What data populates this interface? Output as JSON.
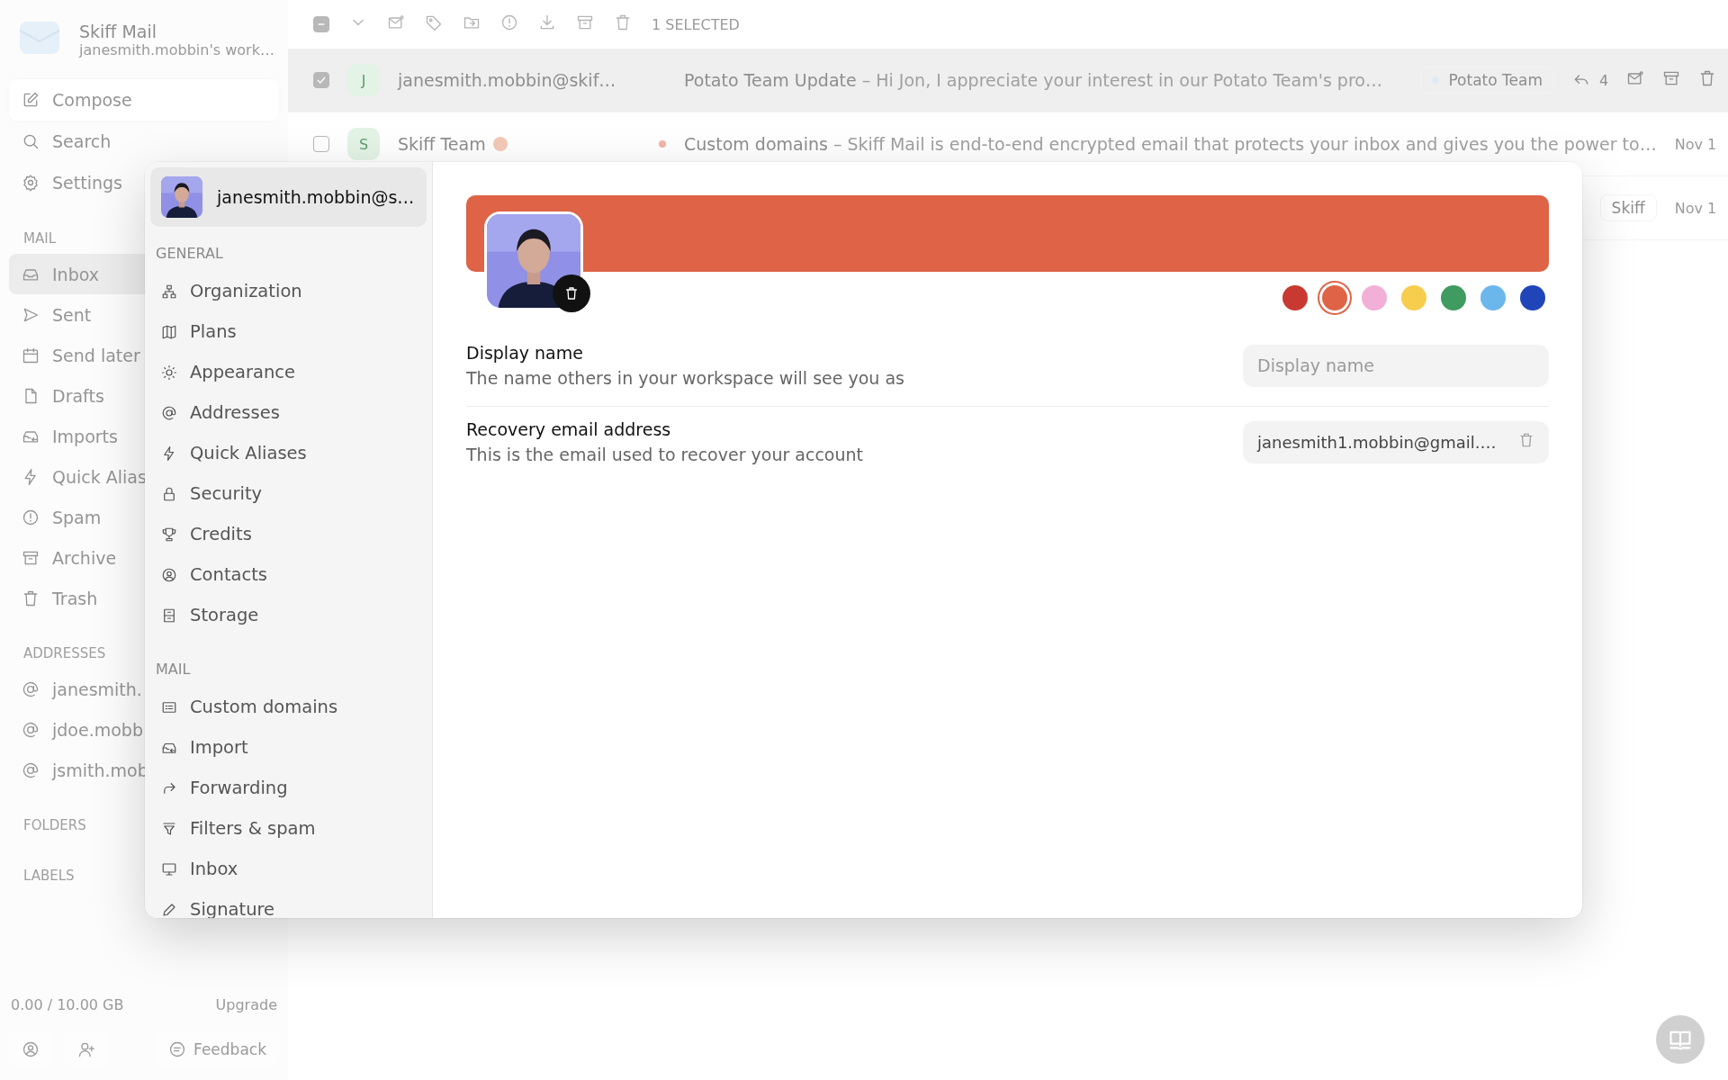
{
  "sidebar": {
    "app_name": "Skiff Mail",
    "workspace": "janesmith.mobbin's work…",
    "actions": [
      {
        "label": "Compose"
      },
      {
        "label": "Search"
      },
      {
        "label": "Settings"
      }
    ],
    "mail_title": "MAIL",
    "mail_items": [
      {
        "label": "Inbox",
        "selected": true
      },
      {
        "label": "Sent",
        "selected": false
      },
      {
        "label": "Send later",
        "selected": false
      },
      {
        "label": "Drafts",
        "selected": false
      },
      {
        "label": "Imports",
        "selected": false
      },
      {
        "label": "Quick Alias",
        "selected": false
      },
      {
        "label": "Spam",
        "selected": false
      },
      {
        "label": "Archive",
        "selected": false
      },
      {
        "label": "Trash",
        "selected": false
      }
    ],
    "addresses_title": "ADDRESSES",
    "addresses": [
      "janesmith.",
      "jdoe.mobb",
      "jsmith.mob"
    ],
    "folders_title": "FOLDERS",
    "labels_title": "LABELS",
    "storage": "0.00 / 10.00 GB",
    "upgrade": "Upgrade",
    "feedback": "Feedback"
  },
  "toolbar": {
    "select_all_partial": true,
    "selected_count": "1 SELECTED"
  },
  "messages": [
    {
      "checked": true,
      "selected": true,
      "avatar": "J",
      "sender": "janesmith.mobbin@skif…",
      "verified": false,
      "unread": false,
      "subject": "Potato Team Update",
      "preview": " – Hi Jon, I appreciate your interest in our Potato Team's pro…",
      "label": "Potato Team",
      "replies": "4"
    },
    {
      "checked": false,
      "selected": false,
      "avatar": "S",
      "sender": "Skiff Team",
      "verified": true,
      "unread": true,
      "subject": "Custom domains",
      "preview": " – Skiff Mail is end-to-end encrypted email that protects your inbox and gives you the power to…",
      "date": "Nov 1"
    },
    {
      "selected": false,
      "label": "Skiff",
      "date": "Nov 1"
    }
  ],
  "settings": {
    "account": {
      "label": "janesmith.mobbin@s…",
      "selected": true
    },
    "sections": [
      {
        "title": "GENERAL",
        "items": [
          {
            "label": "Organization",
            "selected": false
          },
          {
            "label": "Plans",
            "selected": false
          },
          {
            "label": "Appearance",
            "selected": false
          },
          {
            "label": "Addresses",
            "selected": false
          },
          {
            "label": "Quick Aliases",
            "selected": false
          },
          {
            "label": "Security",
            "selected": false
          },
          {
            "label": "Credits",
            "selected": false
          },
          {
            "label": "Contacts",
            "selected": false
          },
          {
            "label": "Storage",
            "selected": false
          }
        ]
      },
      {
        "title": "MAIL",
        "items": [
          {
            "label": "Custom domains",
            "selected": false
          },
          {
            "label": "Import",
            "selected": false
          },
          {
            "label": "Forwarding",
            "selected": false
          },
          {
            "label": "Filters & spam",
            "selected": false
          },
          {
            "label": "Inbox",
            "selected": false
          },
          {
            "label": "Signature",
            "selected": false
          }
        ]
      }
    ],
    "banner_colors": [
      {
        "color": "#c83a31",
        "selected": false
      },
      {
        "color": "#df6346",
        "selected": true
      },
      {
        "color": "#f2b0d6",
        "selected": false
      },
      {
        "color": "#f6cd4c",
        "selected": false
      },
      {
        "color": "#3f9b5f",
        "selected": false
      },
      {
        "color": "#6bb7ec",
        "selected": false
      },
      {
        "color": "#1f45b8",
        "selected": false
      }
    ],
    "fields": [
      {
        "kind": "input",
        "title": "Display name",
        "description": "The name others in your workspace will see you as",
        "placeholder": "Display name"
      },
      {
        "kind": "readonly",
        "title": "Recovery email address",
        "description": "This is the email used to recover your account",
        "value": "janesmith1.mobbin@gmail.…"
      }
    ]
  }
}
